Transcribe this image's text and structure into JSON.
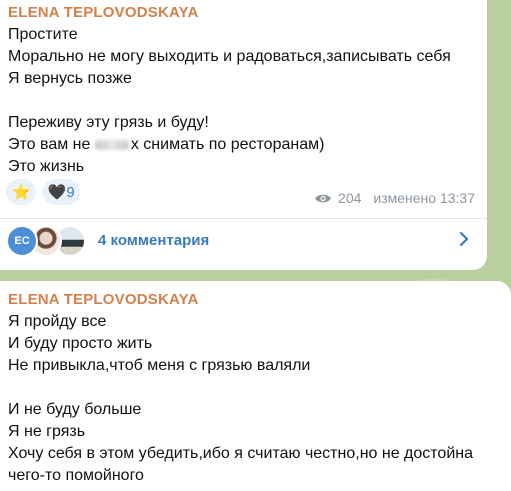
{
  "post1": {
    "author": "ELENA TEPLOVODSKAYA",
    "lines": [
      "Простите",
      "Морально не могу выходить и радоваться,записывать себя",
      "Я вернусь позже",
      "",
      "Переживу эту грязь и буду!",
      "Это вам не ",
      "х снимать по ресторанам)",
      "Это жизнь"
    ],
    "reactions": [
      {
        "emoji": "⭐",
        "count": ""
      },
      {
        "emoji": "🖤",
        "count": "9"
      }
    ],
    "views": "204",
    "edited": "изменено 13:37",
    "comments": {
      "avatar_initials": "EC",
      "label": "4 комментария"
    }
  },
  "post2": {
    "author": "ELENA TEPLOVODSKAYA",
    "lines": [
      "Я пройду все",
      "И буду просто жить",
      "Не привыкла,чтоб меня с грязью валяли",
      "",
      "И не буду больше",
      "Я не грязь",
      "Хочу себя в этом убедить,ибо я считаю честно,но не достойна",
      "чего-то помойного"
    ]
  },
  "colors": {
    "author": "#d3804c",
    "link": "#3a7bc0",
    "meta": "#8c96a0",
    "background": "#b9cf9e"
  }
}
